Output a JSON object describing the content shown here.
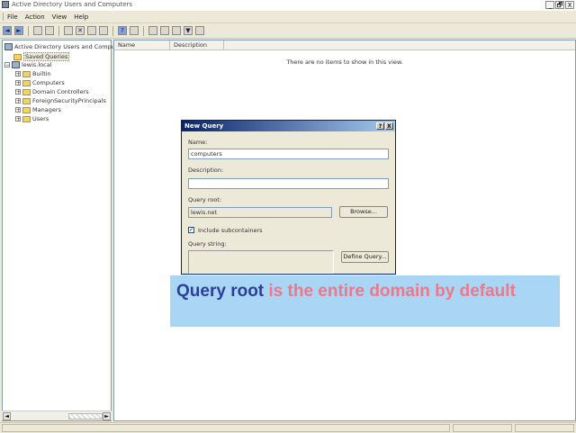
{
  "window": {
    "title": "Active Directory Users and Computers",
    "controls": [
      "_",
      "🗗",
      "X"
    ]
  },
  "menu": [
    "File",
    "Action",
    "View",
    "Help"
  ],
  "toolbar": {
    "icons": [
      "back-arrow-icon",
      "forward-arrow-icon",
      "up-folder-icon",
      "refresh-icon",
      "copy-icon",
      "delete-icon",
      "properties-icon",
      "export-icon",
      "help-icon",
      "find-icon",
      "add-user-icon",
      "add-group-icon",
      "add-ou-icon",
      "filter-icon",
      "add-to-group-icon"
    ]
  },
  "tree": {
    "root": "Active Directory Users and Compu",
    "saved_queries": "Saved Queries",
    "domain": "lewis.local",
    "children": [
      "Builtin",
      "Computers",
      "Domain Controllers",
      "ForeignSecurityPrincipals",
      "Managers",
      "Users"
    ]
  },
  "list": {
    "columns": [
      "Name",
      "Description"
    ],
    "empty_message": "There are no items to show in this view."
  },
  "dialog": {
    "title": "New Query",
    "help_glyph": "?",
    "close_glyph": "X",
    "name_label": "Name:",
    "name_value": "computers",
    "description_label": "Description:",
    "description_value": "",
    "query_root_label": "Query root:",
    "query_root_value": "lewis.net",
    "browse_label": "Browse...",
    "include_subcontainers_label": "Include subcontainers",
    "include_subcontainers_checked": true,
    "query_string_label": "Query string:",
    "define_query_label": "Define Query..."
  },
  "caption": {
    "highlight": "Query root",
    "rest": " is the entire domain by default",
    "highlight_color": "#2c3d9c",
    "rest_color": "#f07688",
    "background": "#a9d6f5"
  },
  "colors": {
    "dialog_title_start": "#0a246a",
    "dialog_title_end": "#a6caf0",
    "chrome": "#ece9d8"
  }
}
